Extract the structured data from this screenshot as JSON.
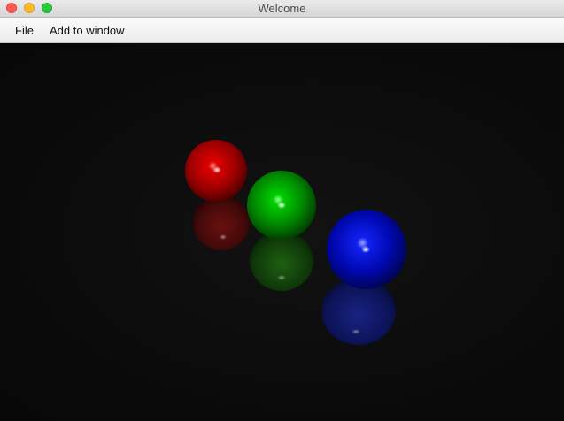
{
  "window": {
    "title": "Welcome"
  },
  "menu": {
    "items": [
      "File",
      "Add to window"
    ]
  },
  "scene": {
    "background": "#0b0b0b",
    "spheres": [
      {
        "name": "red-sphere",
        "color": "#ff0000"
      },
      {
        "name": "green-sphere",
        "color": "#00b800"
      },
      {
        "name": "blue-sphere",
        "color": "#0010ff"
      }
    ]
  }
}
